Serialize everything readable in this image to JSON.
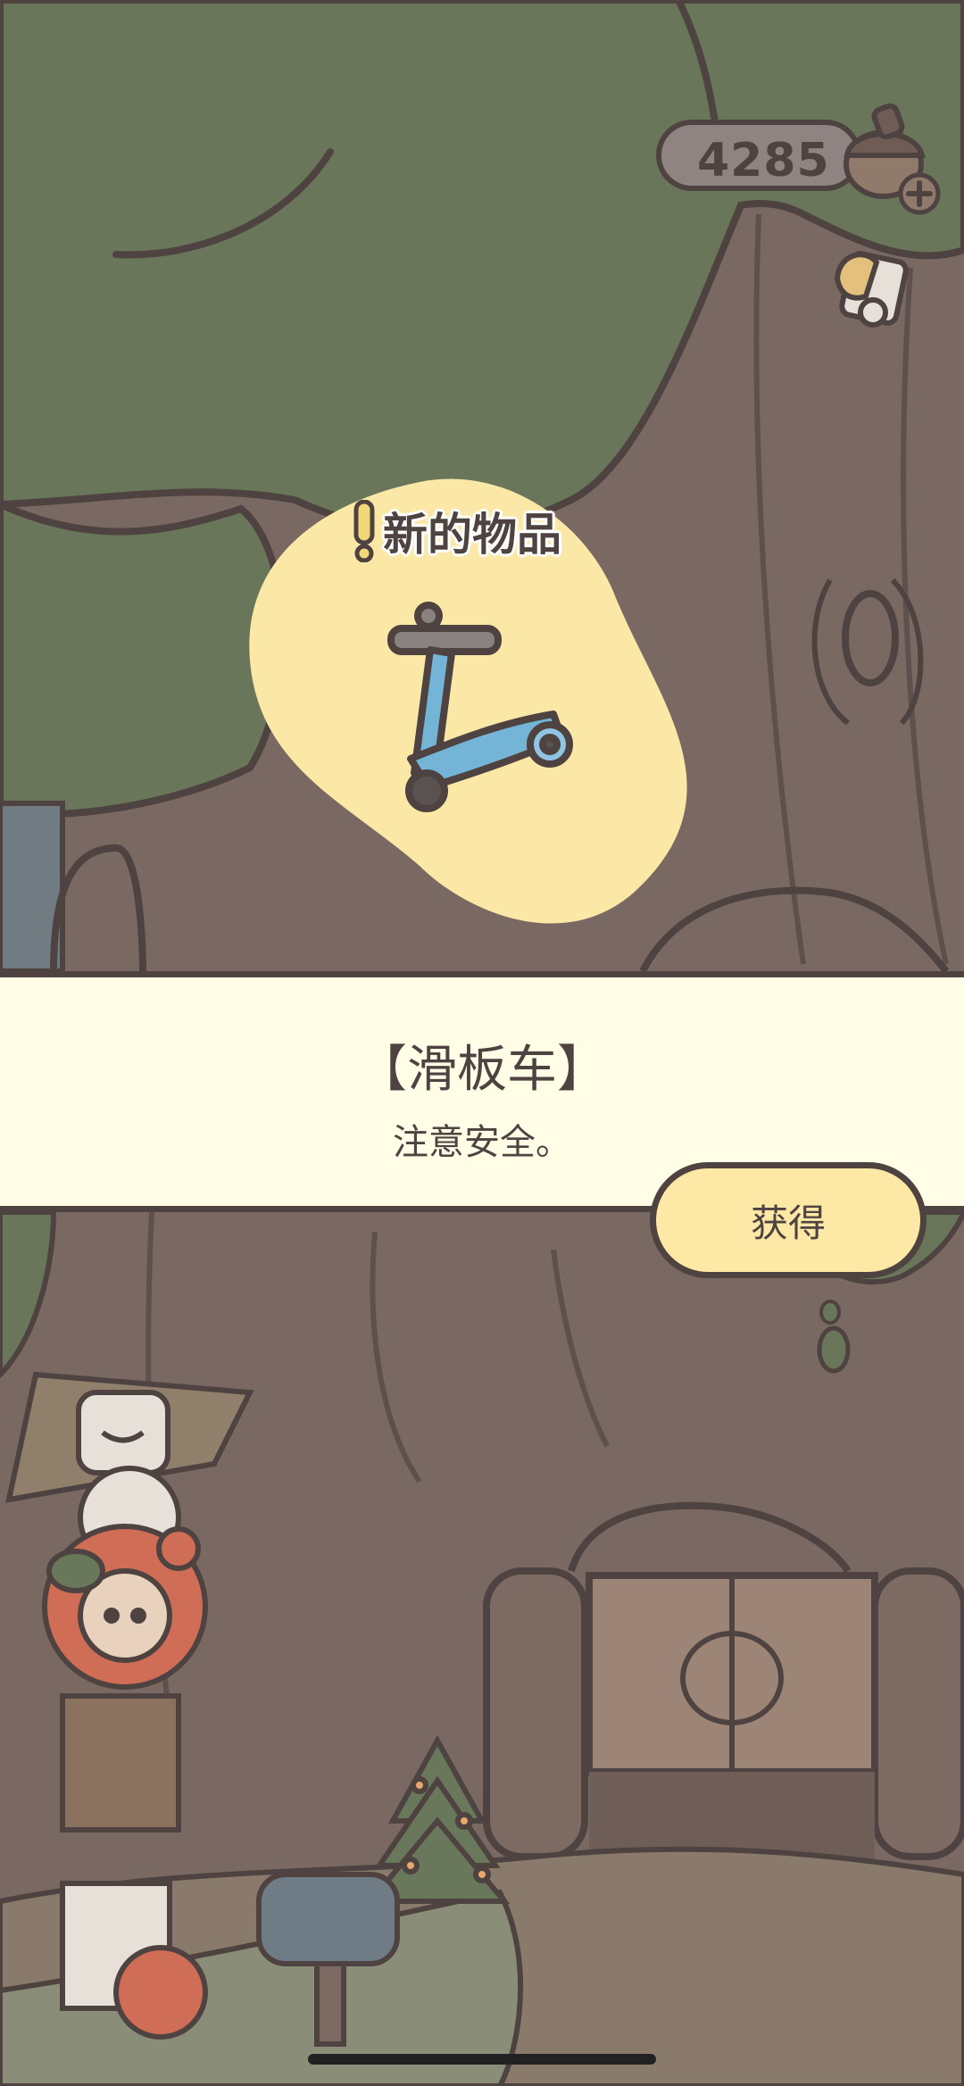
{
  "currency": {
    "amount": "4285",
    "icon": "acorn-icon",
    "add_icon": "plus-icon"
  },
  "shop": {
    "icon": "item-shop-icon"
  },
  "reward": {
    "tag": "新的物品",
    "tag_icon": "exclamation-icon",
    "item_icon": "scooter-icon",
    "item_name": "【滑板车】",
    "item_description": "注意安全。",
    "button_label": "获得"
  },
  "colors": {
    "outline": "#4e4341",
    "banner_bg": "#fffde6",
    "button_bg": "#fde8a6",
    "blob_bg": "#fbe8a7",
    "foliage": "#697659",
    "trunk": "#7a6862",
    "scooter_blue": "#74b4d6"
  }
}
